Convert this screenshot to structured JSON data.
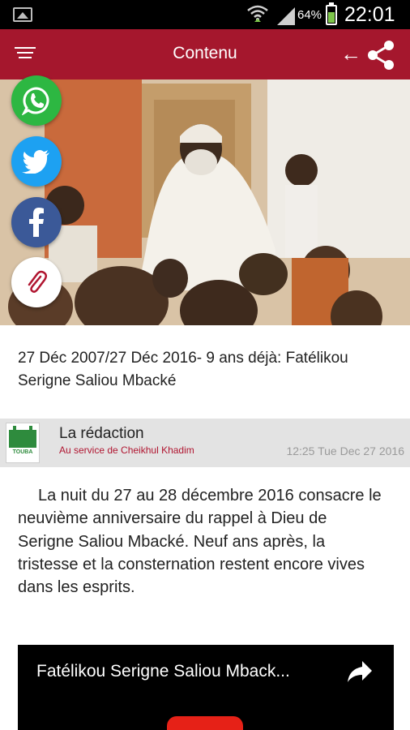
{
  "status_bar": {
    "battery_percent": "64%",
    "time": "22:01",
    "battery_level": 0.64,
    "icons": [
      "gallery-icon",
      "wifi-icon",
      "signal-icon",
      "battery-icon"
    ]
  },
  "app_bar": {
    "title": "Contenu",
    "color": "#a5172d",
    "icons": [
      "menu-icon",
      "back-arrow-icon",
      "share-icon"
    ]
  },
  "share_buttons": [
    {
      "name": "whatsapp",
      "icon": "whatsapp-icon",
      "color": "#2db742"
    },
    {
      "name": "twitter",
      "icon": "twitter-icon",
      "color": "#1da1f2"
    },
    {
      "name": "facebook",
      "icon": "facebook-icon",
      "color": "#3b5998"
    },
    {
      "name": "copy-link",
      "icon": "paperclip-icon",
      "color": "#ffffff"
    }
  ],
  "article": {
    "headline": "27 Déc 2007/27 Déc 2016- 9 ans déjà: Fatélikou Serigne Saliou Mbacké",
    "author": {
      "name": "La rédaction",
      "tagline": "Au service de Cheikhul Khadim",
      "logo_text": "TOUBA",
      "timestamp": "12:25 Tue Dec 27 2016"
    },
    "body": "La nuit du 27 au 28 décembre 2016 consacre le neuvième anniversaire du rappel à Dieu de Serigne Saliou Mbacké. Neuf ans après, la tristesse et la consternation restent encore vives dans les esprits."
  },
  "video": {
    "title": "Fatélikou Serigne Saliou Mback..."
  }
}
